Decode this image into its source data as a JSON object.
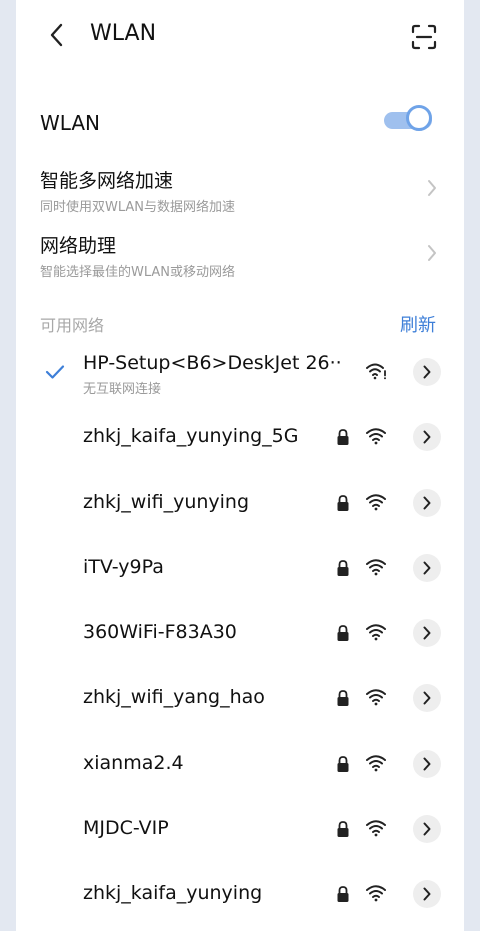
{
  "header": {
    "title": "WLAN",
    "back_icon": "chevron-left-icon",
    "scan_icon": "scan-icon"
  },
  "wlan_toggle": {
    "label": "WLAN",
    "state": "on",
    "accent_color": "#6fa3e8"
  },
  "settings": [
    {
      "title": "智能多网络加速",
      "subtitle": "同时使用双WLAN与数据网络加速"
    },
    {
      "title": "网络助理",
      "subtitle": "智能选择最佳的WLAN或移动网络"
    }
  ],
  "available": {
    "label": "可用网络",
    "refresh_label": "刷新",
    "refresh_color": "#3e7fd8"
  },
  "networks": [
    {
      "ssid": "HP-Setup<B6>DeskJet 26··",
      "status": "无互联网连接",
      "connected": true,
      "secured": false
    },
    {
      "ssid": "zhkj_kaifa_yunying_5G",
      "status": "",
      "connected": false,
      "secured": true
    },
    {
      "ssid": "zhkj_wifi_yunying",
      "status": "",
      "connected": false,
      "secured": true
    },
    {
      "ssid": "iTV-y9Pa",
      "status": "",
      "connected": false,
      "secured": true
    },
    {
      "ssid": "360WiFi-F83A30",
      "status": "",
      "connected": false,
      "secured": true
    },
    {
      "ssid": "zhkj_wifi_yang_hao",
      "status": "",
      "connected": false,
      "secured": true
    },
    {
      "ssid": "xianma2.4",
      "status": "",
      "connected": false,
      "secured": true
    },
    {
      "ssid": "MJDC-VIP",
      "status": "",
      "connected": false,
      "secured": true
    },
    {
      "ssid": "zhkj_kaifa_yunying",
      "status": "",
      "connected": false,
      "secured": true
    }
  ]
}
